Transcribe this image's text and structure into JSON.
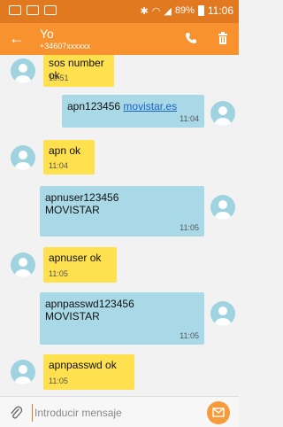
{
  "status_bar": {
    "battery": "89%",
    "time": "11:06"
  },
  "header": {
    "back_icon": "arrow-left-icon",
    "contact_name": "Yo",
    "contact_number": "+34607xxxxxx",
    "actions": [
      "phone-icon",
      "trash-icon"
    ]
  },
  "messages": [
    {
      "direction": "in",
      "text": "sos number ok",
      "time": "10:51"
    },
    {
      "direction": "out",
      "text_prefix": "apn123456 ",
      "link": "movistar.es",
      "time": "11:04"
    },
    {
      "direction": "in",
      "text": "apn ok",
      "time": "11:04"
    },
    {
      "direction": "out",
      "line1": "apnuser123456",
      "line2": "MOVISTAR",
      "time": "11:05"
    },
    {
      "direction": "in",
      "text": "apnuser ok",
      "time": "11:05"
    },
    {
      "direction": "out",
      "line1": "apnpasswd123456",
      "line2": "MOVISTAR",
      "time": "11:05"
    },
    {
      "direction": "in",
      "text": "apnpasswd ok",
      "time": "11:05"
    }
  ],
  "composer": {
    "attach_icon": "paperclip-icon",
    "placeholder": "Introducir mensaje",
    "send_icon": "envelope-icon"
  },
  "colors": {
    "status_bar": "#e0791f",
    "app_bar": "#f7922e",
    "incoming_bubble": "#ffe04f",
    "outgoing_bubble": "#a9d9e6",
    "background": "#f2f2f2"
  }
}
